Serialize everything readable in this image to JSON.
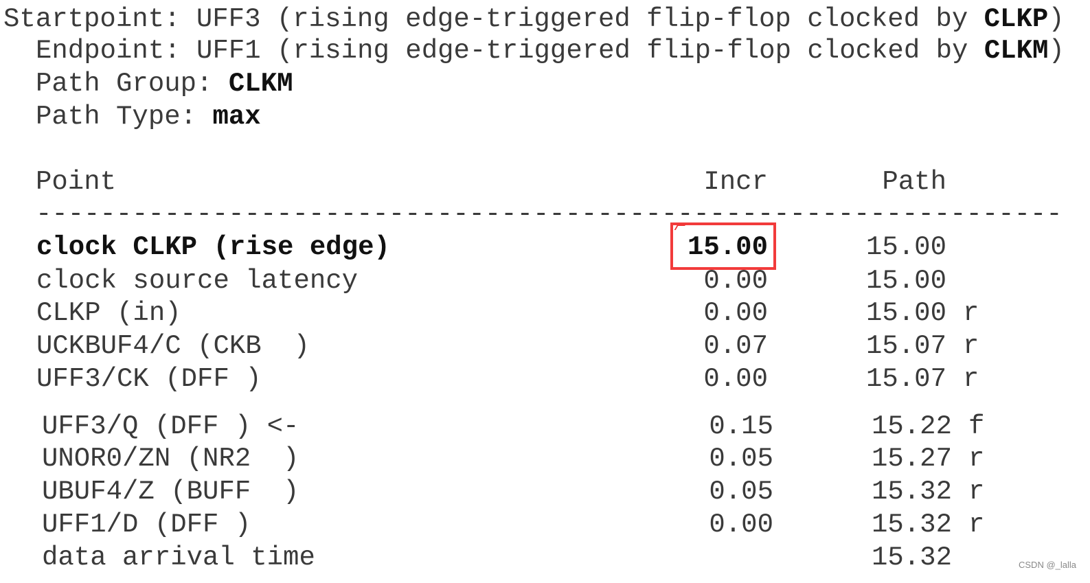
{
  "header": {
    "startpoint_label": "Startpoint: ",
    "startpoint_text": "UFF3 (rising edge-triggered flip-flop clocked by ",
    "startpoint_clock": "CLKP",
    "startpoint_close": ")",
    "endpoint_label": "Endpoint: ",
    "endpoint_text": "UFF1 (rising edge-triggered flip-flop clocked by ",
    "endpoint_clock": "CLKM",
    "endpoint_close": ")",
    "path_group_label": "Path Group: ",
    "path_group": "CLKM",
    "path_type_label": "Path Type: ",
    "path_type": "max"
  },
  "table": {
    "columns": {
      "point": "Point",
      "incr": "Incr",
      "path": "Path"
    },
    "separator": "----------------------------------------------------------------",
    "rows": [
      {
        "point": "clock CLKP (rise edge)",
        "incr": "15.00",
        "path": "15.00",
        "flag": ""
      },
      {
        "point": "clock source latency",
        "incr": "0.00",
        "path": "15.00",
        "flag": ""
      },
      {
        "point": "CLKP (in)",
        "incr": "0.00",
        "path": "15.00",
        "flag": "r"
      },
      {
        "point": "UCKBUF4/C (CKB  )",
        "incr": "0.07",
        "path": "15.07",
        "flag": "r"
      },
      {
        "point": "UFF3/CK (DFF )",
        "incr": "0.00",
        "path": "15.07",
        "flag": "r"
      },
      {
        "point": "UFF3/Q (DFF ) <-",
        "incr": "0.15",
        "path": "15.22",
        "flag": "f"
      },
      {
        "point": "UNOR0/ZN (NR2  )",
        "incr": "0.05",
        "path": "15.27",
        "flag": "r"
      },
      {
        "point": "UBUF4/Z (BUFF  )",
        "incr": "0.05",
        "path": "15.32",
        "flag": "r"
      },
      {
        "point": "UFF1/D (DFF )",
        "incr": "0.00",
        "path": "15.32",
        "flag": "r"
      },
      {
        "point": "data arrival time",
        "incr": "",
        "path": "15.32",
        "flag": ""
      }
    ]
  },
  "highlight_color": "#f23b3b",
  "watermark": "CSDN @_lalla"
}
